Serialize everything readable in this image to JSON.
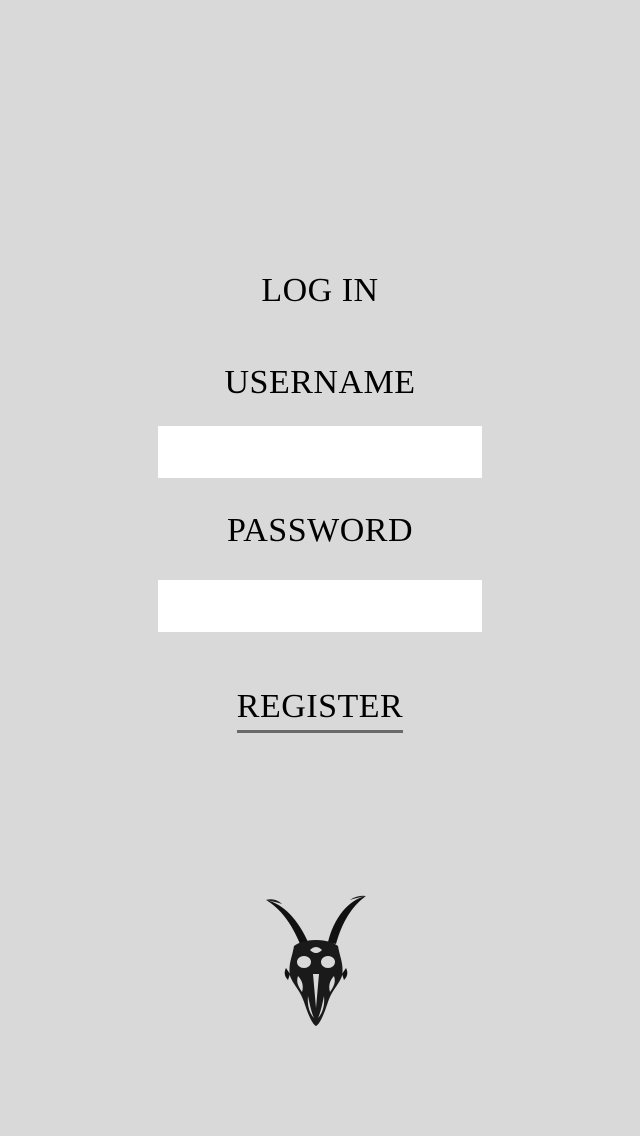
{
  "login": {
    "title": "LOG IN",
    "username_label": "USERNAME",
    "username_value": "",
    "password_label": "PASSWORD",
    "password_value": "",
    "register_label": "REGISTER"
  },
  "logo": {
    "icon": "goat-skull-icon"
  },
  "colors": {
    "background": "#d9d9d9",
    "field": "#ffffff",
    "text": "#000000",
    "underline": "#6a6a6a"
  }
}
